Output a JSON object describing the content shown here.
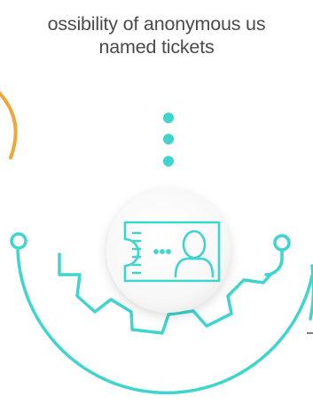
{
  "caption": {
    "line1": "ossibility of anonymous us",
    "line2": "named tickets"
  },
  "colors": {
    "teal": "#3ed5cf",
    "orange": "#f0a63a",
    "text": "#4b4b4b",
    "dash_line": "#555555"
  },
  "icons": {
    "center": "id-ticket-user-icon"
  }
}
